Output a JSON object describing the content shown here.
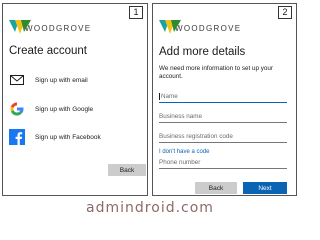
{
  "panel1": {
    "step": "1",
    "logo_text": "WOODGROVE",
    "title": "Create account",
    "providers": [
      {
        "label": "Sign up with email",
        "icon": "mail-icon"
      },
      {
        "label": "Sign up with Google",
        "icon": "google-icon"
      },
      {
        "label": "Sign up with Facebook",
        "icon": "facebook-icon"
      }
    ],
    "back_label": "Back"
  },
  "panel2": {
    "step": "2",
    "logo_text": "WOODGROVE",
    "title": "Add more details",
    "description": "We need more information to set up your account.",
    "fields": {
      "name": "Name",
      "business_name": "Business name",
      "business_reg": "Business registration code",
      "phone": "Phone number"
    },
    "no_code_link": "I don't have a code",
    "back_label": "Back",
    "next_label": "Next"
  },
  "watermark": "admindroid.com",
  "colors": {
    "accent": "#0b63b4",
    "logo_yellow": "#f3c11b",
    "logo_green": "#2e8b2e",
    "logo_teal": "#1aa3a3",
    "facebook": "#1877f2"
  }
}
